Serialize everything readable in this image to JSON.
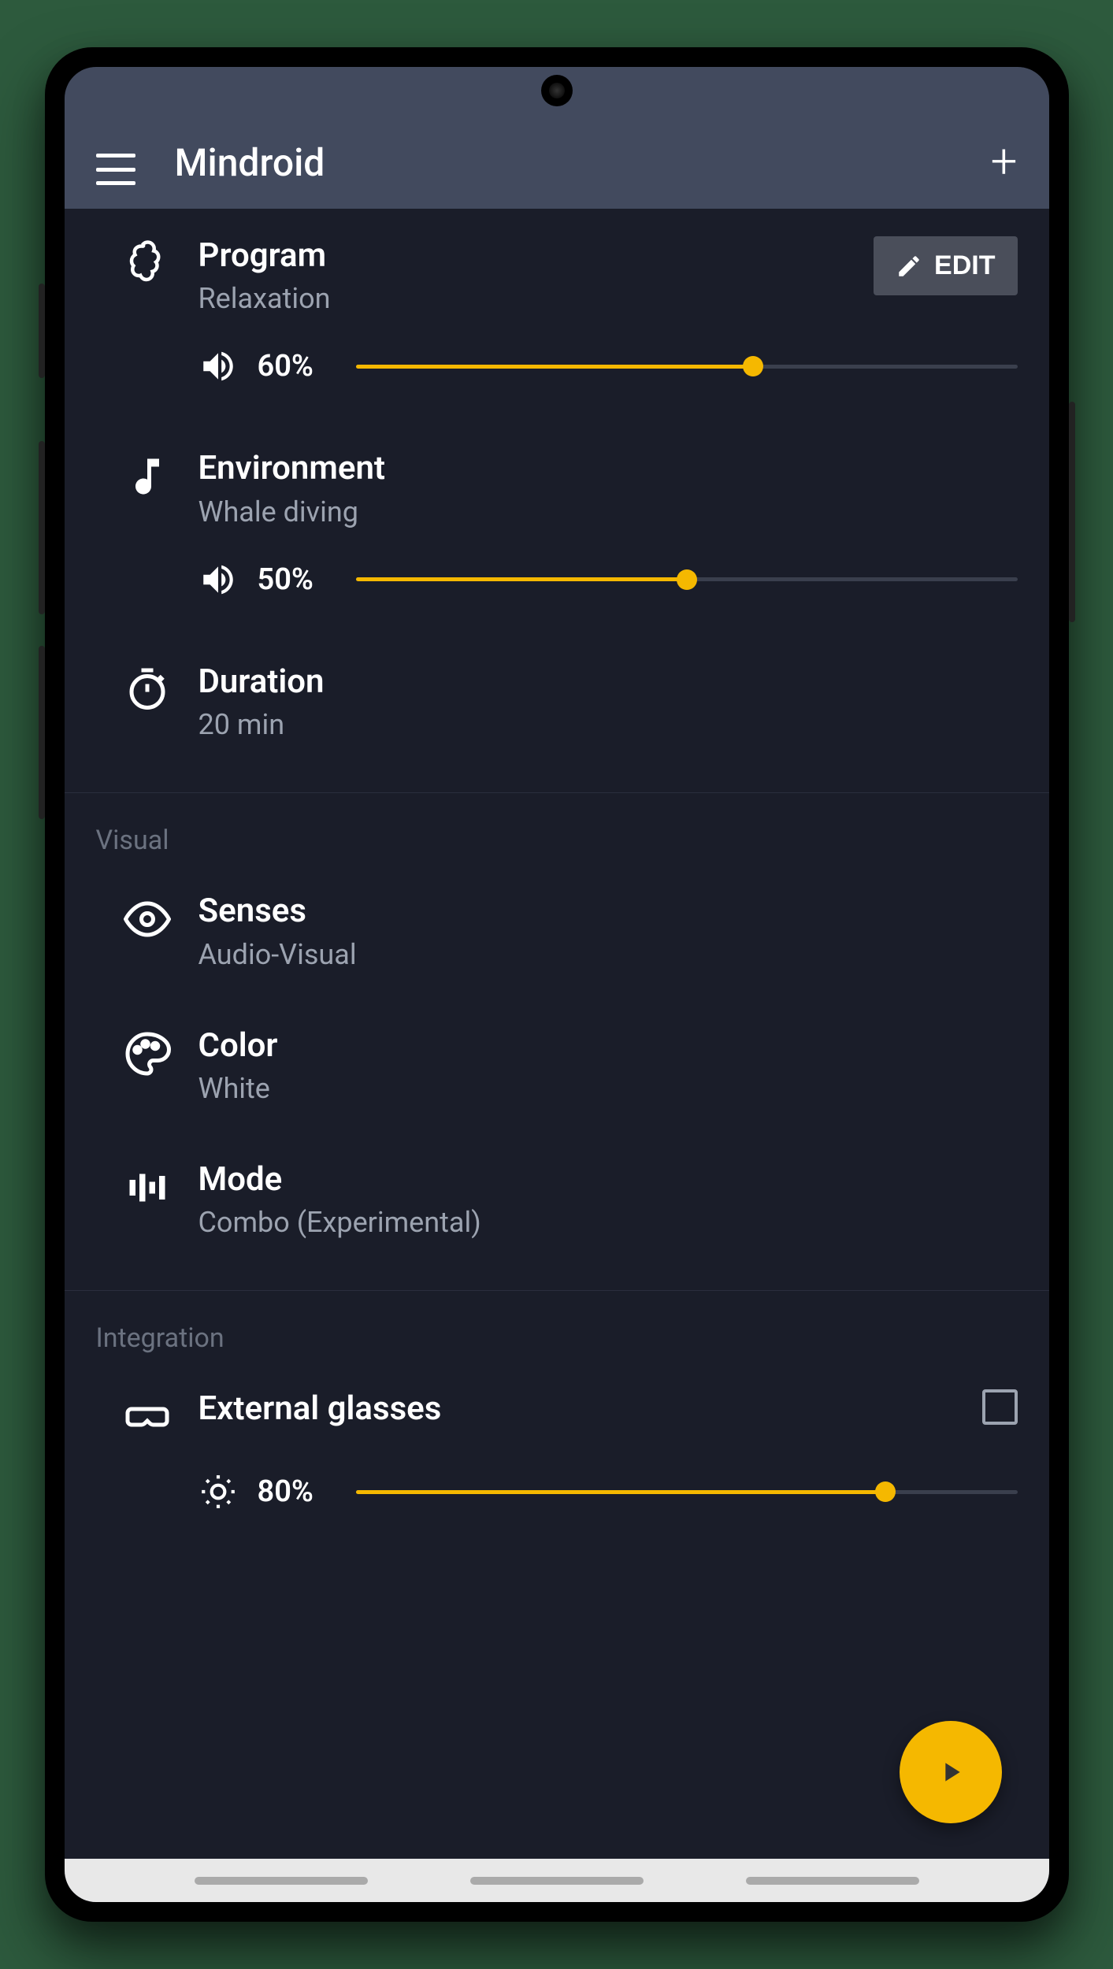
{
  "app_title": "Mindroid",
  "edit_label": "EDIT",
  "items": {
    "program": {
      "label": "Program",
      "value": "Relaxation",
      "volume": "60%",
      "pct": 60
    },
    "environment": {
      "label": "Environment",
      "value": "Whale diving",
      "volume": "50%",
      "pct": 50
    },
    "duration": {
      "label": "Duration",
      "value": "20 min"
    },
    "senses": {
      "label": "Senses",
      "value": "Audio-Visual"
    },
    "color": {
      "label": "Color",
      "value": "White"
    },
    "mode": {
      "label": "Mode",
      "value": "Combo (Experimental)"
    },
    "glasses": {
      "label": "External glasses",
      "brightness": "80%",
      "pct": 80
    }
  },
  "sections": {
    "visual": "Visual",
    "integration": "Integration"
  }
}
